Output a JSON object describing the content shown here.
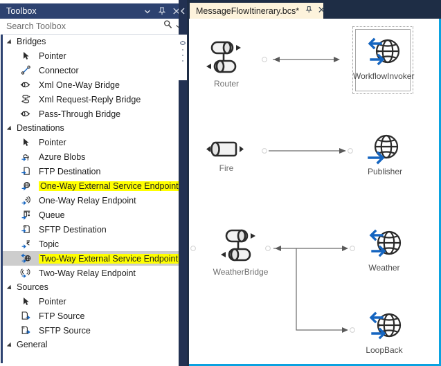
{
  "toolbox": {
    "title": "Toolbox",
    "window_buttons": [
      {
        "name": "dropdown-icon",
        "glyph": "chevron-down"
      },
      {
        "name": "pin-icon",
        "glyph": "pin"
      },
      {
        "name": "close-icon",
        "glyph": "close"
      }
    ],
    "search": {
      "placeholder": "Search Toolbox",
      "value": "",
      "icons": [
        "search-icon",
        "dropdown-arrow-icon"
      ]
    },
    "groups": [
      {
        "label": "Bridges",
        "expanded": true,
        "items": [
          {
            "label": "Pointer",
            "icon": "pointer-icon",
            "highlighted": false,
            "selected": false
          },
          {
            "label": "Connector",
            "icon": "connector-icon",
            "highlighted": false,
            "selected": false
          },
          {
            "label": "Xml One-Way Bridge",
            "icon": "one-way-bridge-icon",
            "highlighted": false,
            "selected": false
          },
          {
            "label": "Xml Request-Reply Bridge",
            "icon": "request-reply-bridge-icon",
            "highlighted": false,
            "selected": false
          },
          {
            "label": "Pass-Through Bridge",
            "icon": "pass-through-bridge-icon",
            "highlighted": false,
            "selected": false
          }
        ]
      },
      {
        "label": "Destinations",
        "expanded": true,
        "items": [
          {
            "label": "Pointer",
            "icon": "pointer-icon",
            "highlighted": false,
            "selected": false
          },
          {
            "label": "Azure Blobs",
            "icon": "azure-blobs-icon",
            "highlighted": false,
            "selected": false
          },
          {
            "label": "FTP Destination",
            "icon": "ftp-destination-icon",
            "highlighted": false,
            "selected": false
          },
          {
            "label": "One-Way External Service Endpoint",
            "icon": "one-way-endpoint-icon",
            "highlighted": true,
            "selected": false
          },
          {
            "label": "One-Way Relay Endpoint",
            "icon": "one-way-relay-icon",
            "highlighted": false,
            "selected": false
          },
          {
            "label": "Queue",
            "icon": "queue-icon",
            "highlighted": false,
            "selected": false
          },
          {
            "label": "SFTP Destination",
            "icon": "sftp-destination-icon",
            "highlighted": false,
            "selected": false
          },
          {
            "label": "Topic",
            "icon": "topic-icon",
            "highlighted": false,
            "selected": false
          },
          {
            "label": "Two-Way External Service Endpoint",
            "icon": "two-way-endpoint-icon",
            "highlighted": true,
            "selected": true
          },
          {
            "label": "Two-Way Relay Endpoint",
            "icon": "two-way-relay-icon",
            "highlighted": false,
            "selected": false
          }
        ]
      },
      {
        "label": "Sources",
        "expanded": true,
        "items": [
          {
            "label": "Pointer",
            "icon": "pointer-icon",
            "highlighted": false,
            "selected": false
          },
          {
            "label": "FTP Source",
            "icon": "ftp-source-icon",
            "highlighted": false,
            "selected": false
          },
          {
            "label": "SFTP Source",
            "icon": "sftp-source-icon",
            "highlighted": false,
            "selected": false
          }
        ]
      },
      {
        "label": "General",
        "expanded": true,
        "items": []
      }
    ]
  },
  "editor": {
    "tab": {
      "name": "MessageFlowItinerary.bcs*",
      "pin_icon": "pin-icon",
      "close_icon": "close-icon"
    },
    "diagram": {
      "nodes": [
        {
          "id": "router",
          "label": "Router",
          "shape": "request-reply-bridge",
          "selected": false
        },
        {
          "id": "workflowinvoker",
          "label": "WorkflowInvoker",
          "shape": "two-way-endpoint",
          "selected": true
        },
        {
          "id": "fire",
          "label": "Fire",
          "shape": "one-way-bridge",
          "selected": false
        },
        {
          "id": "publisher",
          "label": "Publisher",
          "shape": "one-way-endpoint",
          "selected": false
        },
        {
          "id": "weatherbridge",
          "label": "WeatherBridge",
          "shape": "request-reply-bridge",
          "selected": false
        },
        {
          "id": "weather",
          "label": "Weather",
          "shape": "two-way-endpoint",
          "selected": false
        },
        {
          "id": "loopback",
          "label": "LoopBack",
          "shape": "two-way-endpoint",
          "selected": false
        }
      ],
      "connections": [
        {
          "from": "router",
          "to": "workflowinvoker",
          "type": "bidirectional"
        },
        {
          "from": "fire",
          "to": "publisher",
          "type": "one-way"
        },
        {
          "from": "weatherbridge",
          "to": "weather",
          "type": "bidirectional"
        },
        {
          "from": "weatherbridge",
          "to": "loopback",
          "type": "one-way"
        }
      ]
    }
  },
  "colors": {
    "titlebar": "#2d4270",
    "tab_background": "#fdf3dc",
    "highlight": "#ffff00",
    "selection": "#cdcdcd",
    "accent_blue": "#0aa2e0",
    "icon_blue": "#1565c0",
    "shell_background": "#1e2d45"
  }
}
